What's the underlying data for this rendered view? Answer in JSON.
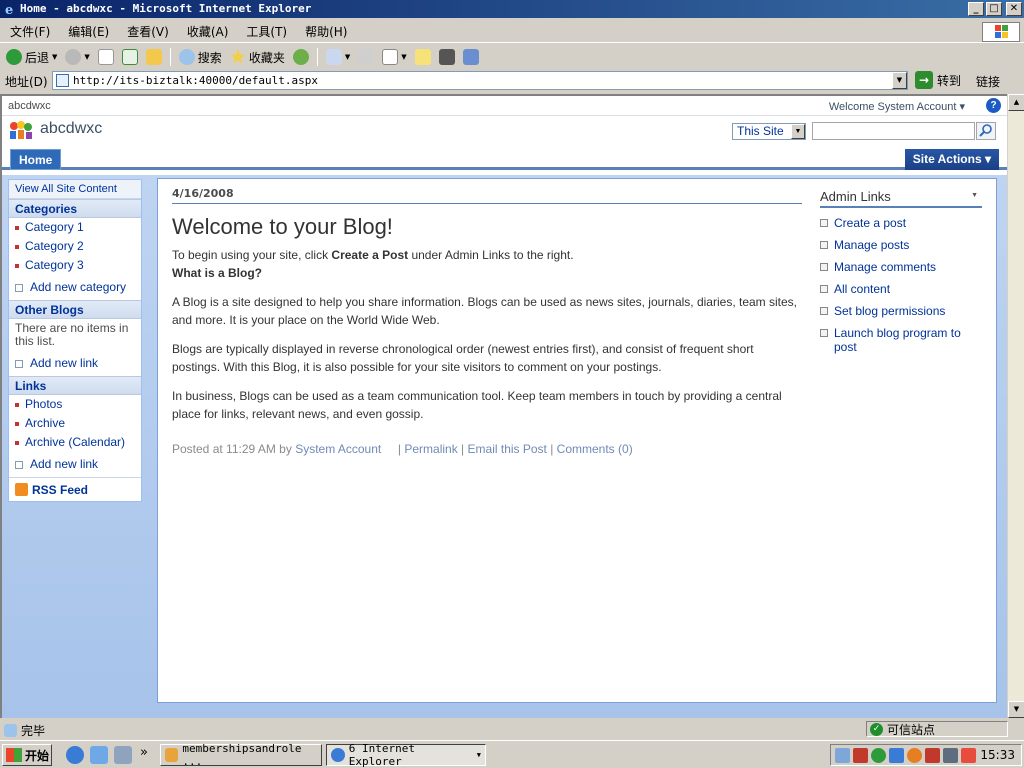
{
  "window": {
    "title": "Home - abcdwxc - Microsoft Internet Explorer",
    "controls": [
      "_",
      "□",
      "✕"
    ]
  },
  "menubar": [
    "文件(F)",
    "编辑(E)",
    "查看(V)",
    "收藏(A)",
    "工具(T)",
    "帮助(H)"
  ],
  "toolbar": {
    "back": "后退",
    "search": "搜索",
    "favorites": "收藏夹"
  },
  "addressbar": {
    "label": "地址(D)",
    "url": "http://its-biztalk:40000/default.aspx",
    "go": "转到",
    "links": "链接"
  },
  "sharepoint": {
    "breadcrumb": "abcdwxc",
    "welcome": "Welcome System Account ▾",
    "help": "?",
    "site_title": "abcdwxc",
    "search_scope": "This Site",
    "search_value": "",
    "nav": {
      "home": "Home",
      "site_actions": "Site Actions ▾"
    },
    "quicklaunch": {
      "view_all": "View All Site Content",
      "categories_heading": "Categories",
      "categories": [
        "Category 1",
        "Category 2",
        "Category 3"
      ],
      "add_category": "Add new category",
      "other_blogs_heading": "Other Blogs",
      "no_items": "There are no items in this list.",
      "add_link_1": "Add new link",
      "links_heading": "Links",
      "links": [
        "Photos",
        "Archive",
        "Archive (Calendar)"
      ],
      "add_link_2": "Add new link",
      "rss": "RSS Feed"
    },
    "post": {
      "date": "4/16/2008",
      "title": "Welcome to your Blog!",
      "intro_pre": "To begin using your site, click ",
      "intro_bold": "Create a Post",
      "intro_post": " under Admin Links to the right.",
      "subheading": "What is a Blog?",
      "p1": "A Blog is a site designed to help you share information. Blogs can be used as news sites, journals, diaries, team sites, and more. It is your place on the World Wide Web.",
      "p2": "Blogs are typically displayed in reverse chronological order (newest entries first), and consist of frequent short postings. With this Blog, it is also possible for your site visitors to comment on your postings.",
      "p3": "In business, Blogs can be used as a team communication tool. Keep team members in touch by providing a central place for links, relevant news, and even gossip.",
      "posted_prefix": "Posted at 11:29 AM by ",
      "author": "System Account",
      "permalink": "Permalink",
      "email": "Email this Post",
      "comments": "Comments (0)"
    },
    "admin": {
      "heading": "Admin Links",
      "items": [
        "Create a post",
        "Manage posts",
        "Manage comments",
        "All content",
        "Set blog permissions",
        "Launch blog program to post"
      ]
    }
  },
  "statusbar": {
    "status": "完毕",
    "zone": "可信站点"
  },
  "taskbar": {
    "start": "开始",
    "chevron": "»",
    "task1": "membershipsandrole ...",
    "task2": "6 Internet Explorer",
    "clock": "15:33"
  }
}
